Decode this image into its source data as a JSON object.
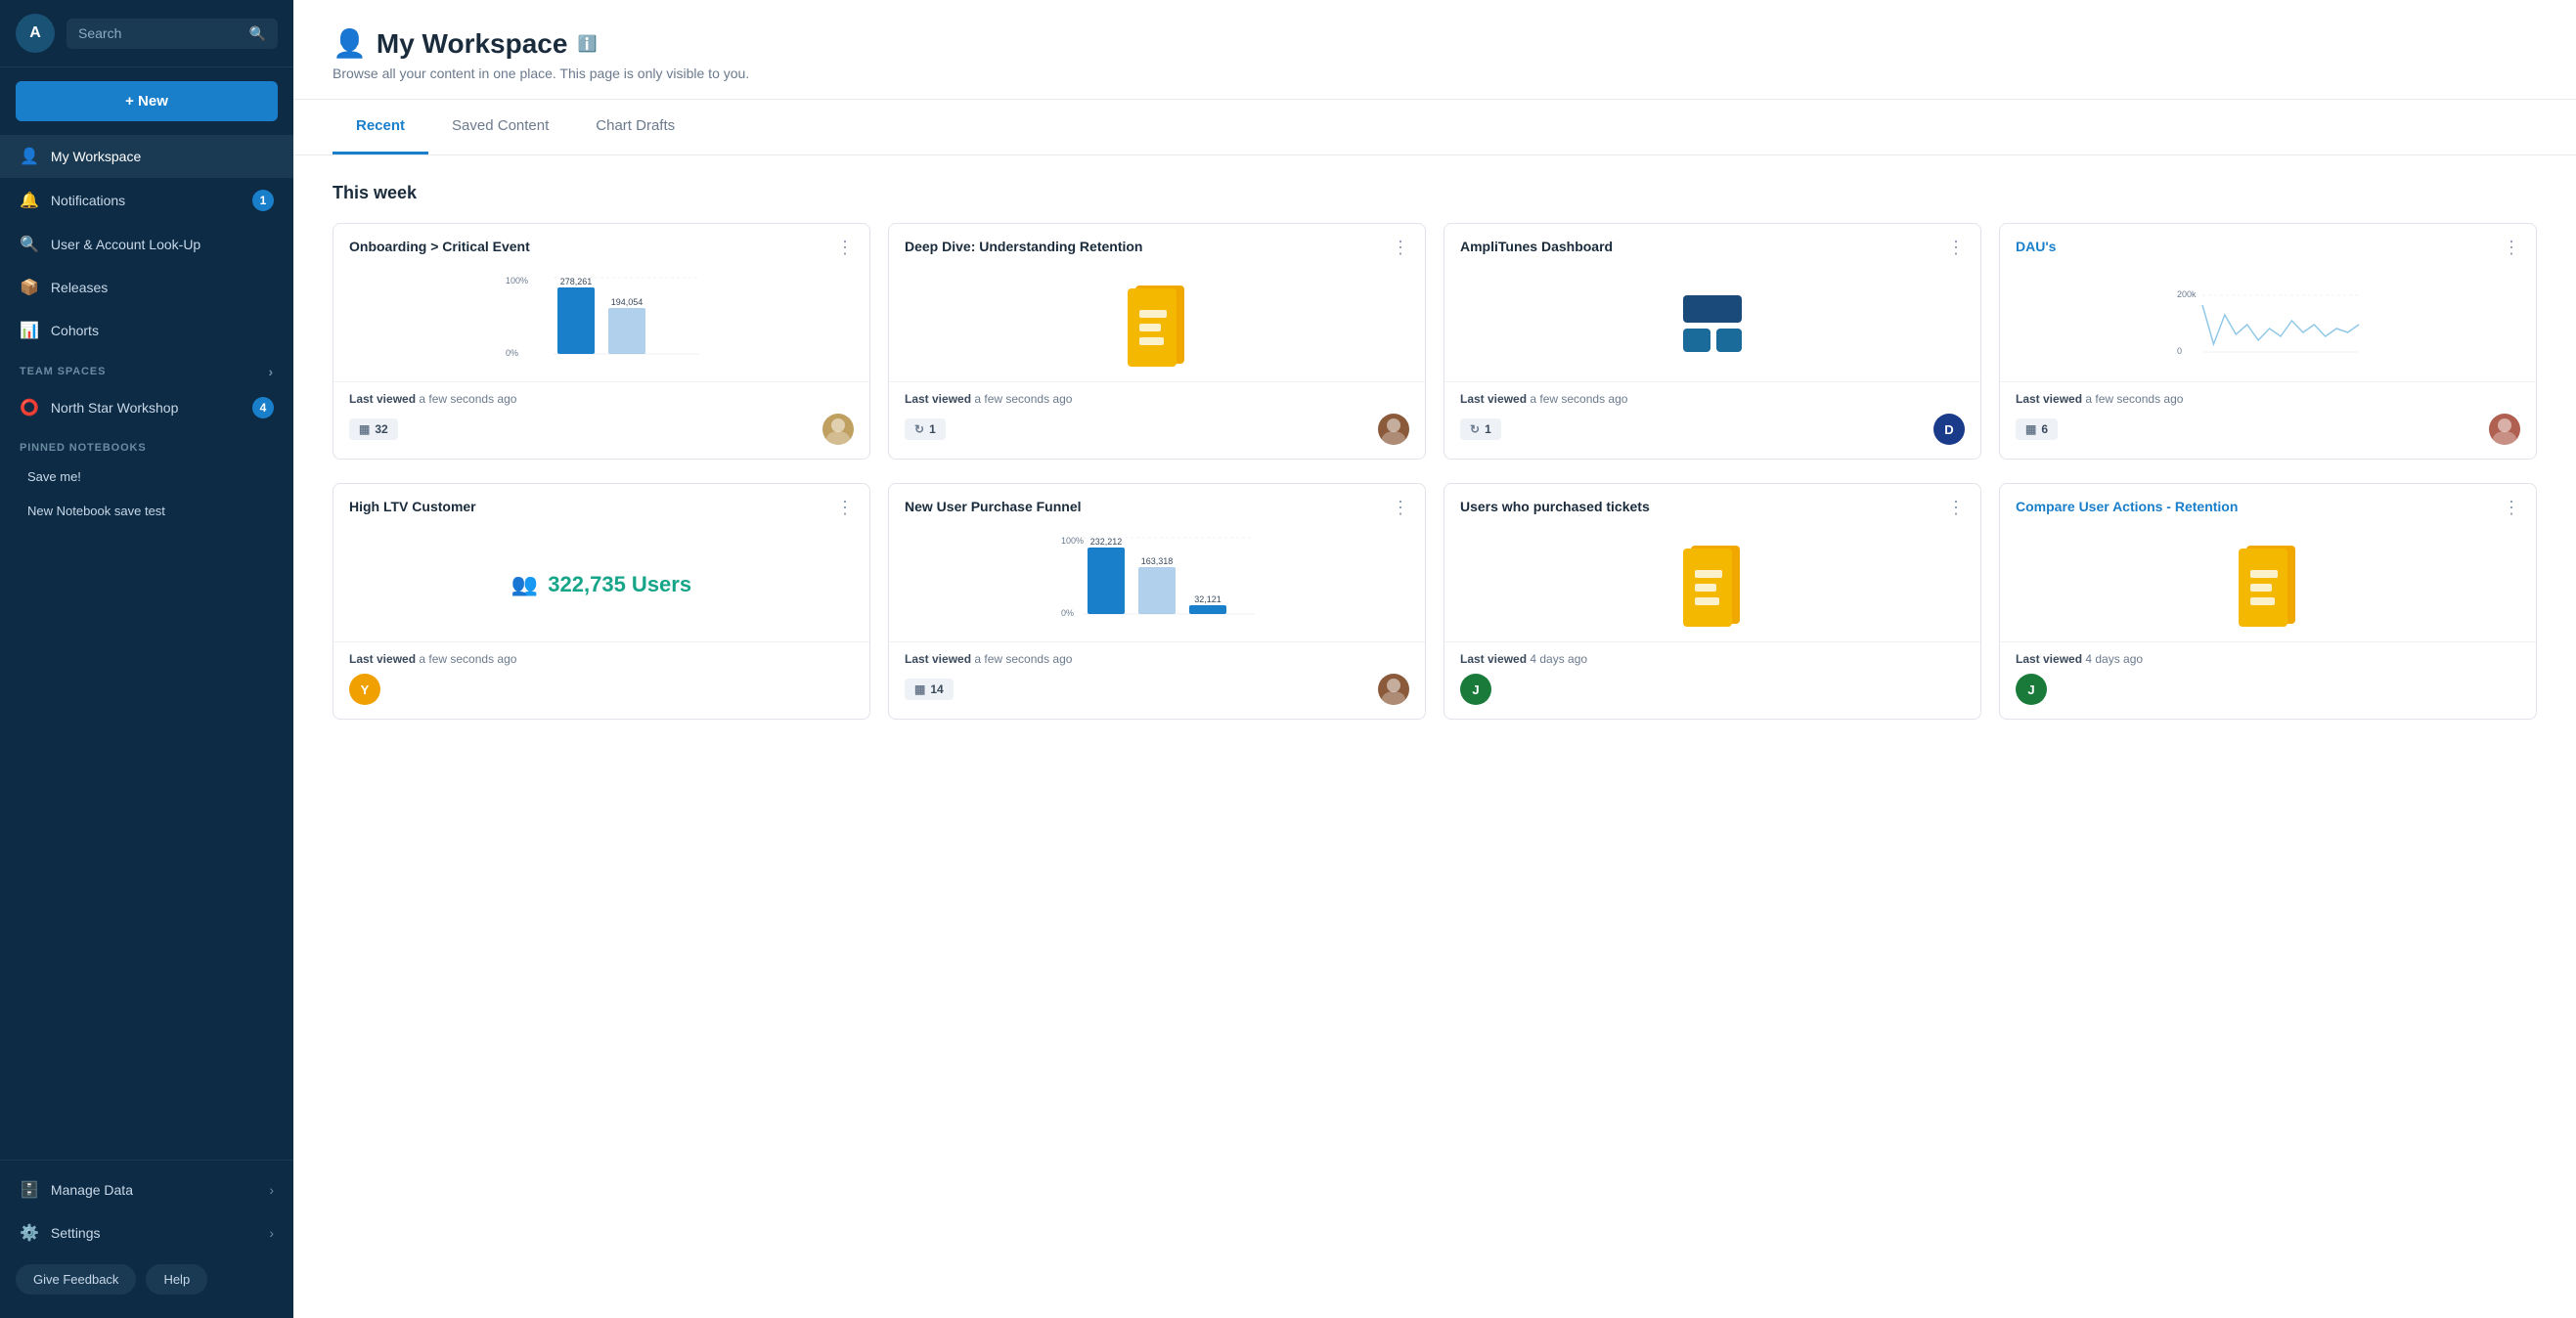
{
  "app": {
    "logo_text": "A",
    "search_placeholder": "Search"
  },
  "sidebar": {
    "new_label": "+ New",
    "nav_items": [
      {
        "id": "my-workspace",
        "label": "My Workspace",
        "icon": "👤",
        "active": true,
        "badge": null
      },
      {
        "id": "notifications",
        "label": "Notifications",
        "icon": "🔔",
        "active": false,
        "badge": "1"
      },
      {
        "id": "user-account",
        "label": "User & Account Look-Up",
        "icon": "🔍",
        "active": false,
        "badge": null
      },
      {
        "id": "releases",
        "label": "Releases",
        "icon": "📦",
        "active": false,
        "badge": null
      },
      {
        "id": "cohorts",
        "label": "Cohorts",
        "icon": "📊",
        "active": false,
        "badge": null
      }
    ],
    "team_spaces_label": "TEAM SPACES",
    "team_spaces_items": [
      {
        "id": "north-star",
        "label": "North Star Workshop",
        "badge": "4"
      }
    ],
    "pinned_notebooks_label": "PINNED NOTEBOOKS",
    "pinned_items": [
      {
        "id": "save-me",
        "label": "Save me!"
      },
      {
        "id": "new-notebook",
        "label": "New Notebook save test"
      }
    ],
    "bottom_items": [
      {
        "id": "manage-data",
        "label": "Manage Data",
        "icon": "🗄️",
        "has_arrow": true
      },
      {
        "id": "settings",
        "label": "Settings",
        "icon": "⚙️",
        "has_arrow": true
      }
    ],
    "feedback_label": "Give Feedback",
    "help_label": "Help"
  },
  "main": {
    "page_icon": "👤",
    "page_title": "My Workspace",
    "page_subtitle": "Browse all your content in one place. This page is only visible to you.",
    "tabs": [
      {
        "id": "recent",
        "label": "Recent",
        "active": true
      },
      {
        "id": "saved-content",
        "label": "Saved Content",
        "active": false
      },
      {
        "id": "chart-drafts",
        "label": "Chart Drafts",
        "active": false
      }
    ],
    "this_week_label": "This week",
    "cards_row1": [
      {
        "id": "onboarding-critical",
        "title": "Onboarding > Critical Event",
        "title_color": "normal",
        "chart_type": "bar",
        "chart_data": {
          "bars": [
            278261,
            194054
          ],
          "max": 310000,
          "label_100": "100%",
          "label_0": "0%"
        },
        "last_viewed_label": "Last viewed",
        "last_viewed_time": "a few seconds ago",
        "badge_count": "32",
        "badge_icon": "grid",
        "avatar_color": "#c0a060",
        "avatar_type": "image"
      },
      {
        "id": "deep-dive-retention",
        "title": "Deep Dive: Understanding Retention",
        "title_color": "normal",
        "chart_type": "notebook",
        "last_viewed_label": "Last viewed",
        "last_viewed_time": "a few seconds ago",
        "badge_count": "1",
        "badge_icon": "refresh",
        "avatar_color": "#8a5a3a",
        "avatar_type": "image"
      },
      {
        "id": "amplitunes-dashboard",
        "title": "AmpliTunes Dashboard",
        "title_color": "normal",
        "chart_type": "blocks",
        "last_viewed_label": "Last viewed",
        "last_viewed_time": "a few seconds ago",
        "badge_count": "1",
        "badge_icon": "refresh",
        "avatar_color": "#1a3a8a",
        "avatar_letter": "D",
        "avatar_type": "letter"
      },
      {
        "id": "daus",
        "title": "DAU's",
        "title_color": "blue",
        "chart_type": "line",
        "chart_data": {
          "y_max": "200k",
          "y_min": "0"
        },
        "last_viewed_label": "Last viewed",
        "last_viewed_time": "a few seconds ago",
        "badge_count": "6",
        "badge_icon": "grid",
        "avatar_color": "#b06050",
        "avatar_type": "image"
      }
    ],
    "cards_row2": [
      {
        "id": "high-ltv",
        "title": "High LTV Customer",
        "title_color": "normal",
        "chart_type": "metric",
        "metric_value": "322,735 Users",
        "last_viewed_label": "Last viewed",
        "last_viewed_time": "a few seconds ago",
        "badge_count": null,
        "avatar_color": "#f0a000",
        "avatar_letter": "Y",
        "avatar_type": "letter"
      },
      {
        "id": "new-user-purchase",
        "title": "New User Purchase Funnel",
        "title_color": "normal",
        "chart_type": "bar2",
        "chart_data": {
          "bars": [
            232212,
            163318,
            32121
          ],
          "label_100": "100%",
          "label_0": "0%"
        },
        "last_viewed_label": "Last viewed",
        "last_viewed_time": "a few seconds ago",
        "badge_count": "14",
        "badge_icon": "grid",
        "avatar_color": "#8a5a3a",
        "avatar_type": "image"
      },
      {
        "id": "users-purchased-tickets",
        "title": "Users who purchased tickets",
        "title_color": "normal",
        "chart_type": "notebook",
        "last_viewed_label": "Last viewed",
        "last_viewed_time": "4 days ago",
        "badge_count": null,
        "avatar_color": "#1a7a3a",
        "avatar_letter": "J",
        "avatar_type": "letter"
      },
      {
        "id": "compare-user-actions",
        "title": "Compare User Actions - Retention",
        "title_color": "blue",
        "chart_type": "notebook",
        "last_viewed_label": "Last viewed",
        "last_viewed_time": "4 days ago",
        "badge_count": null,
        "avatar_color": "#1a7a3a",
        "avatar_letter": "J",
        "avatar_type": "letter"
      }
    ]
  }
}
